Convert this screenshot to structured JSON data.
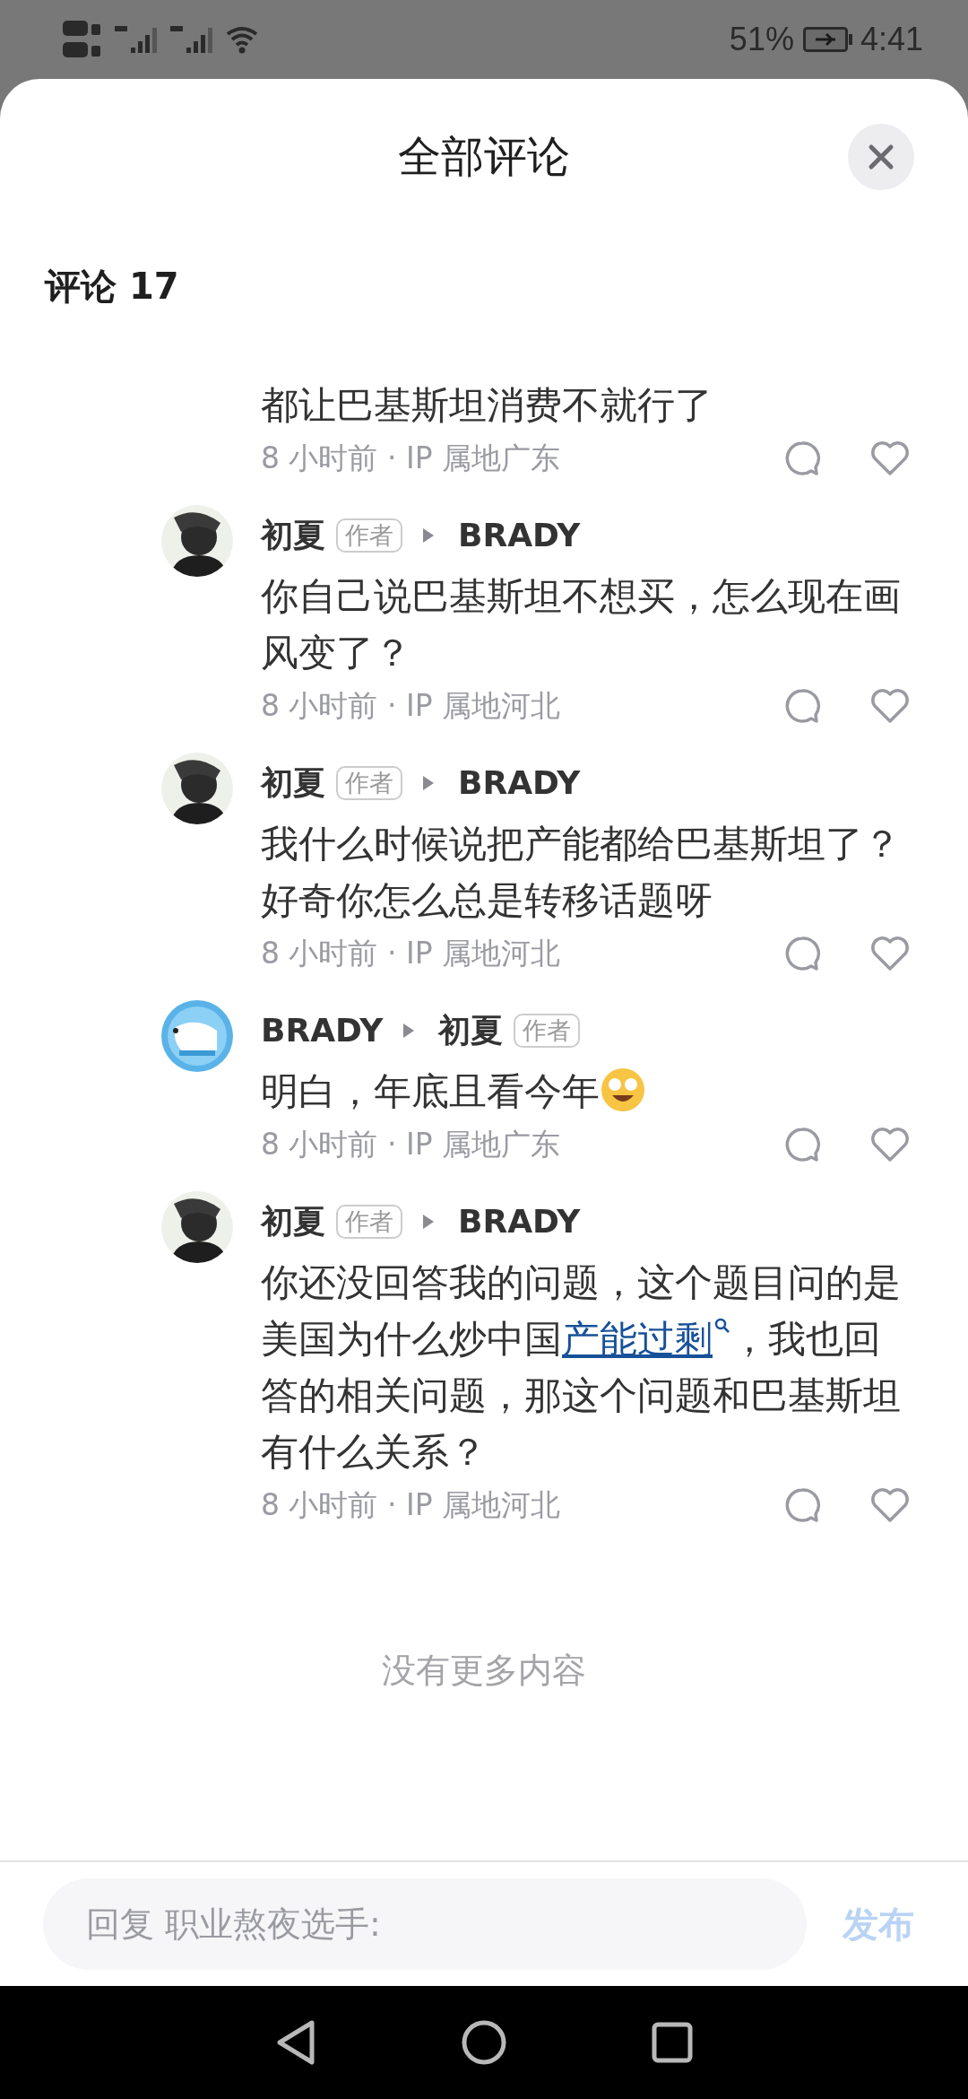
{
  "status_bar": {
    "battery": "51%",
    "time": "4:41"
  },
  "sheet": {
    "title": "全部评论"
  },
  "comments_header": "评论 17",
  "comments": [
    {
      "text_parts": [
        {
          "kind": "text",
          "text": "都让巴基斯坦消费不就行了"
        }
      ],
      "meta": "8 小时前 · IP 属地广东"
    },
    {
      "avatar": {
        "kind": "mask"
      },
      "author": {
        "name": "初夏",
        "badge": "作者"
      },
      "reply_to": {
        "name": "BRADY"
      },
      "text_parts": [
        {
          "kind": "text",
          "text": "你自己说巴基斯坦不想买，怎么现在画风变了？"
        }
      ],
      "meta": "8 小时前 · IP 属地河北"
    },
    {
      "avatar": {
        "kind": "mask"
      },
      "author": {
        "name": "初夏",
        "badge": "作者"
      },
      "reply_to": {
        "name": "BRADY"
      },
      "text_parts": [
        {
          "kind": "text",
          "text": "我什么时候说把产能都给巴基斯坦了？好奇你怎么总是转移话题呀"
        }
      ],
      "meta": "8 小时前 · IP 属地河北"
    },
    {
      "avatar": {
        "kind": "bear"
      },
      "author": {
        "name": "BRADY"
      },
      "reply_to": {
        "name": "初夏",
        "badge": "作者"
      },
      "text_parts": [
        {
          "kind": "text",
          "text": "明白，年底且看今年"
        },
        {
          "kind": "emoji"
        }
      ],
      "meta": "8 小时前 · IP 属地广东"
    },
    {
      "avatar": {
        "kind": "mask"
      },
      "author": {
        "name": "初夏",
        "badge": "作者"
      },
      "reply_to": {
        "name": "BRADY"
      },
      "text_parts": [
        {
          "kind": "text",
          "text": "你还没回答我的问题，这个题目问的是美国为什么炒中国"
        },
        {
          "kind": "link",
          "text": "产能过剩"
        },
        {
          "kind": "text",
          "text": "，我也回答的相关问题，那这个问题和巴基斯坦有什么关系？"
        }
      ],
      "meta": "8 小时前 · IP 属地河北"
    }
  ],
  "end_note": "没有更多内容",
  "reply_box": {
    "placeholder": "回复 职业熬夜选手:"
  },
  "publish_button": {
    "label": "发布",
    "disabled": true
  }
}
